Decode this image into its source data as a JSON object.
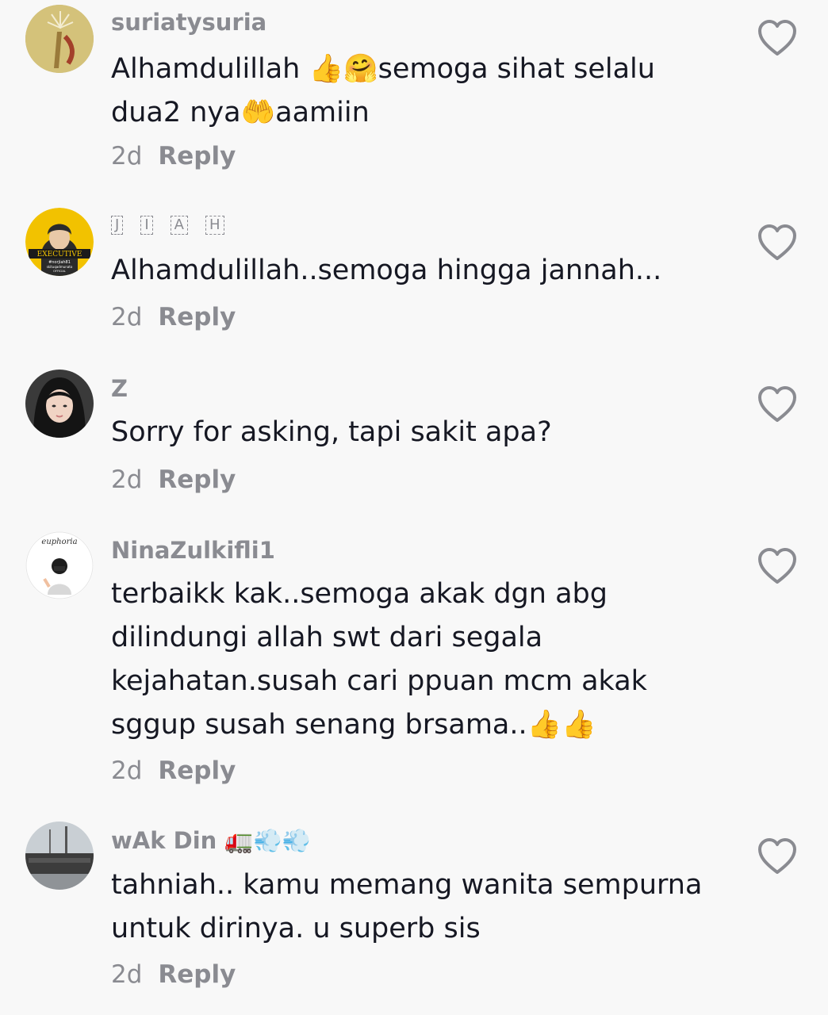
{
  "comments": [
    {
      "username": "suriatysuria",
      "text": "Alhamdulillah 👍🤗semoga sihat selalu\ndua2 nya🤲aamiin",
      "time": "2d",
      "reply": "Reply"
    },
    {
      "username_letters": [
        "J",
        "I",
        "A",
        "H"
      ],
      "text": "Alhamdulillah..semoga hingga jannah...",
      "time": "2d",
      "reply": "Reply",
      "avatar_text": {
        "badge": "EXECUTIVE",
        "line1": "#norjiah81",
        "line2": "skituqadmunato",
        "line3": "OFFICIAL"
      }
    },
    {
      "username": "Z",
      "text": "Sorry for asking, tapi sakit apa?",
      "time": "2d",
      "reply": "Reply"
    },
    {
      "username": "NinaZulkifli1",
      "text": "terbaikk kak..semoga akak dgn abg\ndilindungi allah swt dari segala\nkejahatan.susah cari ppuan mcm akak\nsggup susah senang brsama..👍👍",
      "time": "2d",
      "reply": "Reply",
      "avatar_text": "euphoria"
    },
    {
      "username": "wAk Din 🚛💨💨",
      "text": "tahniah.. kamu memang wanita sempurna\nuntuk dirinya. u superb sis",
      "time": "2d",
      "reply": "Reply"
    }
  ],
  "icons": {
    "like": "heart-outline-icon"
  },
  "colors": {
    "background": "#f8f8f8",
    "text": "#161823",
    "secondary": "#8a8b91"
  }
}
